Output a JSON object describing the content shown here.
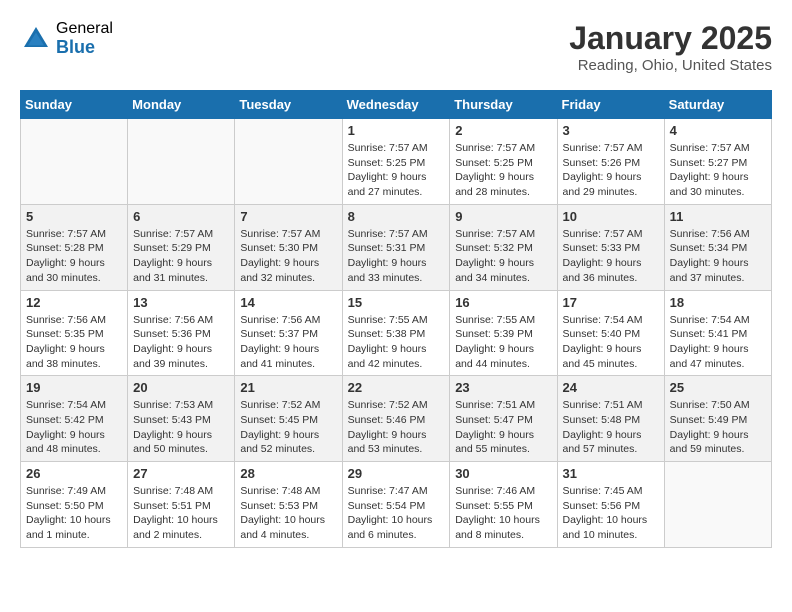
{
  "header": {
    "logo_general": "General",
    "logo_blue": "Blue",
    "month_title": "January 2025",
    "location": "Reading, Ohio, United States"
  },
  "days_of_week": [
    "Sunday",
    "Monday",
    "Tuesday",
    "Wednesday",
    "Thursday",
    "Friday",
    "Saturday"
  ],
  "weeks": [
    {
      "shaded": false,
      "days": [
        {
          "num": "",
          "empty": true
        },
        {
          "num": "",
          "empty": true
        },
        {
          "num": "",
          "empty": true
        },
        {
          "num": "1",
          "empty": false,
          "sunrise": "7:57 AM",
          "sunset": "5:25 PM",
          "daylight": "9 hours and 27 minutes."
        },
        {
          "num": "2",
          "empty": false,
          "sunrise": "7:57 AM",
          "sunset": "5:25 PM",
          "daylight": "9 hours and 28 minutes."
        },
        {
          "num": "3",
          "empty": false,
          "sunrise": "7:57 AM",
          "sunset": "5:26 PM",
          "daylight": "9 hours and 29 minutes."
        },
        {
          "num": "4",
          "empty": false,
          "sunrise": "7:57 AM",
          "sunset": "5:27 PM",
          "daylight": "9 hours and 30 minutes."
        }
      ]
    },
    {
      "shaded": true,
      "days": [
        {
          "num": "5",
          "empty": false,
          "sunrise": "7:57 AM",
          "sunset": "5:28 PM",
          "daylight": "9 hours and 30 minutes."
        },
        {
          "num": "6",
          "empty": false,
          "sunrise": "7:57 AM",
          "sunset": "5:29 PM",
          "daylight": "9 hours and 31 minutes."
        },
        {
          "num": "7",
          "empty": false,
          "sunrise": "7:57 AM",
          "sunset": "5:30 PM",
          "daylight": "9 hours and 32 minutes."
        },
        {
          "num": "8",
          "empty": false,
          "sunrise": "7:57 AM",
          "sunset": "5:31 PM",
          "daylight": "9 hours and 33 minutes."
        },
        {
          "num": "9",
          "empty": false,
          "sunrise": "7:57 AM",
          "sunset": "5:32 PM",
          "daylight": "9 hours and 34 minutes."
        },
        {
          "num": "10",
          "empty": false,
          "sunrise": "7:57 AM",
          "sunset": "5:33 PM",
          "daylight": "9 hours and 36 minutes."
        },
        {
          "num": "11",
          "empty": false,
          "sunrise": "7:56 AM",
          "sunset": "5:34 PM",
          "daylight": "9 hours and 37 minutes."
        }
      ]
    },
    {
      "shaded": false,
      "days": [
        {
          "num": "12",
          "empty": false,
          "sunrise": "7:56 AM",
          "sunset": "5:35 PM",
          "daylight": "9 hours and 38 minutes."
        },
        {
          "num": "13",
          "empty": false,
          "sunrise": "7:56 AM",
          "sunset": "5:36 PM",
          "daylight": "9 hours and 39 minutes."
        },
        {
          "num": "14",
          "empty": false,
          "sunrise": "7:56 AM",
          "sunset": "5:37 PM",
          "daylight": "9 hours and 41 minutes."
        },
        {
          "num": "15",
          "empty": false,
          "sunrise": "7:55 AM",
          "sunset": "5:38 PM",
          "daylight": "9 hours and 42 minutes."
        },
        {
          "num": "16",
          "empty": false,
          "sunrise": "7:55 AM",
          "sunset": "5:39 PM",
          "daylight": "9 hours and 44 minutes."
        },
        {
          "num": "17",
          "empty": false,
          "sunrise": "7:54 AM",
          "sunset": "5:40 PM",
          "daylight": "9 hours and 45 minutes."
        },
        {
          "num": "18",
          "empty": false,
          "sunrise": "7:54 AM",
          "sunset": "5:41 PM",
          "daylight": "9 hours and 47 minutes."
        }
      ]
    },
    {
      "shaded": true,
      "days": [
        {
          "num": "19",
          "empty": false,
          "sunrise": "7:54 AM",
          "sunset": "5:42 PM",
          "daylight": "9 hours and 48 minutes."
        },
        {
          "num": "20",
          "empty": false,
          "sunrise": "7:53 AM",
          "sunset": "5:43 PM",
          "daylight": "9 hours and 50 minutes."
        },
        {
          "num": "21",
          "empty": false,
          "sunrise": "7:52 AM",
          "sunset": "5:45 PM",
          "daylight": "9 hours and 52 minutes."
        },
        {
          "num": "22",
          "empty": false,
          "sunrise": "7:52 AM",
          "sunset": "5:46 PM",
          "daylight": "9 hours and 53 minutes."
        },
        {
          "num": "23",
          "empty": false,
          "sunrise": "7:51 AM",
          "sunset": "5:47 PM",
          "daylight": "9 hours and 55 minutes."
        },
        {
          "num": "24",
          "empty": false,
          "sunrise": "7:51 AM",
          "sunset": "5:48 PM",
          "daylight": "9 hours and 57 minutes."
        },
        {
          "num": "25",
          "empty": false,
          "sunrise": "7:50 AM",
          "sunset": "5:49 PM",
          "daylight": "9 hours and 59 minutes."
        }
      ]
    },
    {
      "shaded": false,
      "days": [
        {
          "num": "26",
          "empty": false,
          "sunrise": "7:49 AM",
          "sunset": "5:50 PM",
          "daylight": "10 hours and 1 minute."
        },
        {
          "num": "27",
          "empty": false,
          "sunrise": "7:48 AM",
          "sunset": "5:51 PM",
          "daylight": "10 hours and 2 minutes."
        },
        {
          "num": "28",
          "empty": false,
          "sunrise": "7:48 AM",
          "sunset": "5:53 PM",
          "daylight": "10 hours and 4 minutes."
        },
        {
          "num": "29",
          "empty": false,
          "sunrise": "7:47 AM",
          "sunset": "5:54 PM",
          "daylight": "10 hours and 6 minutes."
        },
        {
          "num": "30",
          "empty": false,
          "sunrise": "7:46 AM",
          "sunset": "5:55 PM",
          "daylight": "10 hours and 8 minutes."
        },
        {
          "num": "31",
          "empty": false,
          "sunrise": "7:45 AM",
          "sunset": "5:56 PM",
          "daylight": "10 hours and 10 minutes."
        },
        {
          "num": "",
          "empty": true
        }
      ]
    }
  ],
  "labels": {
    "sunrise": "Sunrise:",
    "sunset": "Sunset:",
    "daylight": "Daylight:"
  }
}
